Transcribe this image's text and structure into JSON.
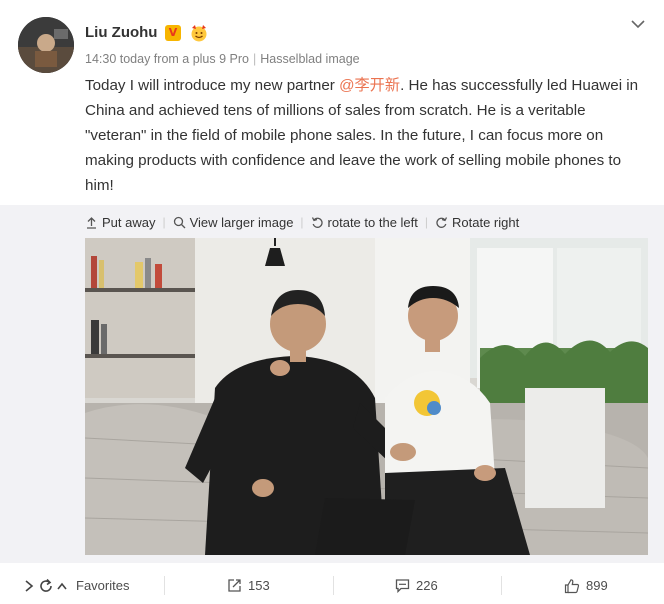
{
  "post": {
    "author": "Liu Zuohu",
    "vip_badge": "V",
    "time": "14:30 today from a plus 9 Pro",
    "separator": "|",
    "source": "Hasselblad image",
    "text_before": "Today I will introduce my new partner ",
    "mention": "@李开新",
    "text_after": ". He has successfully led Huawei in China and achieved tens of millions of sales from scratch. He is a veritable \"veteran\" in the field of mobile phone sales. In the future, I can focus more on making products with confidence and leave the work of selling mobile phones to him!"
  },
  "media_toolbar": {
    "put_away": "Put away",
    "view_larger": "View larger image",
    "rotate_left": "rotate to the left",
    "rotate_right": "Rotate right",
    "separator": "|"
  },
  "actions": {
    "favorites": "Favorites",
    "reposts": "153",
    "comments": "226",
    "likes": "899"
  },
  "colors": {
    "mention": "#eb7350",
    "vip": "#f7b500",
    "panel_bg": "#f2f2f5"
  },
  "icons": [
    "chevron-down-icon",
    "vip-v-icon",
    "fan-emoji-icon",
    "put-away-icon",
    "search-icon",
    "rotate-left-icon",
    "rotate-right-icon",
    "chevron-right-icon",
    "refresh-icon",
    "chevron-up-icon",
    "repost-icon",
    "comment-icon",
    "like-icon"
  ]
}
